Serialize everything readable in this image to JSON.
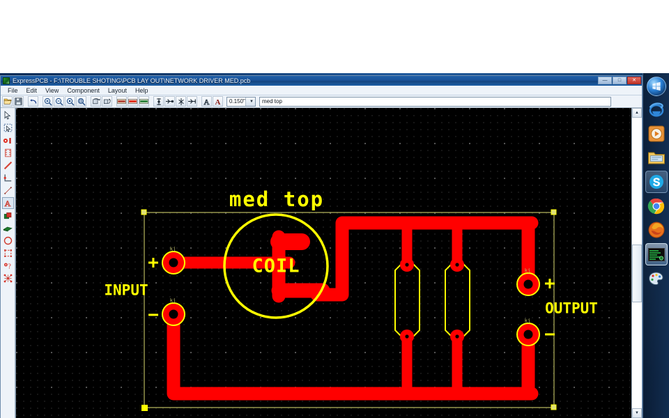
{
  "window": {
    "title": "ExpressPCB - F:\\TROUBLE SHOTING\\PCB LAY OUT\\NETWORK DRIVER MED.pcb",
    "app_icon": "expresspcb-icon",
    "controls": {
      "minimize": "—",
      "maximize": "□",
      "close": "✕"
    }
  },
  "menubar": {
    "items": [
      {
        "label": "File"
      },
      {
        "label": "Edit"
      },
      {
        "label": "View"
      },
      {
        "label": "Component"
      },
      {
        "label": "Layout"
      },
      {
        "label": "Help"
      }
    ]
  },
  "toolbar": {
    "buttons": [
      {
        "name": "open-file-button",
        "icon": "folder-open-icon",
        "tip": "Open"
      },
      {
        "name": "save-file-button",
        "icon": "floppy-disk-icon",
        "tip": "Save"
      },
      {
        "name": "undo-button",
        "icon": "undo-arrow-icon",
        "tip": "Undo"
      },
      {
        "name": "zoom-in-button",
        "icon": "magnifier-plus-icon",
        "tip": "Zoom In"
      },
      {
        "name": "zoom-out-button",
        "icon": "magnifier-minus-icon",
        "tip": "Zoom Out"
      },
      {
        "name": "zoom-fit-button",
        "icon": "magnifier-icon",
        "tip": "Zoom to Fit"
      },
      {
        "name": "zoom-area-button",
        "icon": "magnifier-box-icon",
        "tip": "Zoom Area"
      },
      {
        "name": "rotate-component-button",
        "icon": "rotate-part-icon",
        "tip": "Rotate"
      },
      {
        "name": "flip-component-button",
        "icon": "flip-part-icon",
        "tip": "Flip"
      },
      {
        "name": "top-layer-button",
        "icon": "top-copper-layer-icon",
        "tip": "Top layer"
      },
      {
        "name": "bottom-layer-button",
        "icon": "bottom-copper-layer-icon",
        "tip": "Bottom layer"
      },
      {
        "name": "silkscreen-layer-button",
        "icon": "silkscreen-layer-icon",
        "tip": "Silkscreen layer"
      },
      {
        "name": "insert-via-button",
        "icon": "insert-via-icon",
        "tip": "Insert via"
      },
      {
        "name": "trim-trace-button",
        "icon": "trim-trace-icon",
        "tip": "Trim trace"
      },
      {
        "name": "split-trace-button",
        "icon": "split-trace-icon",
        "tip": "Split trace"
      },
      {
        "name": "extend-trace-button",
        "icon": "extend-trace-icon",
        "tip": "Extend trace"
      },
      {
        "name": "text-small-button",
        "icon": "text-outline-icon",
        "tip": "Text"
      },
      {
        "name": "text-bold-button",
        "icon": "text-bold-icon",
        "tip": "Bold Text"
      }
    ],
    "trace_width": {
      "value": "0.150\"",
      "arrow": "▼"
    },
    "text_field": {
      "value": "med top",
      "placeholder": ""
    }
  },
  "palette": {
    "tools": [
      {
        "name": "select-tool",
        "icon": "arrow-cursor-icon",
        "selected": false
      },
      {
        "name": "select-rectangle-tool",
        "icon": "marquee-select-icon",
        "selected": false
      },
      {
        "name": "place-pad-tool",
        "icon": "pad-icon",
        "selected": false
      },
      {
        "name": "place-component-tool",
        "icon": "component-footprint-icon",
        "selected": false
      },
      {
        "name": "place-trace-tool",
        "icon": "diagonal-trace-icon",
        "selected": false
      },
      {
        "name": "place-trace-corner-tool",
        "icon": "trace-corner-icon",
        "selected": false
      },
      {
        "name": "place-line-tool",
        "icon": "thin-line-icon",
        "selected": false
      },
      {
        "name": "place-text-tool",
        "icon": "letter-a-icon",
        "selected": true
      },
      {
        "name": "place-rect-filled-tool",
        "icon": "filled-rectangle-icon",
        "selected": false
      },
      {
        "name": "place-plane-tool",
        "icon": "copper-plane-icon",
        "selected": false
      },
      {
        "name": "place-circle-tool",
        "icon": "circle-outline-icon",
        "selected": false
      },
      {
        "name": "place-rect-outline-tool",
        "icon": "rect-outline-icon",
        "selected": false
      },
      {
        "name": "insert-via-tool",
        "icon": "via-question-icon",
        "selected": false
      },
      {
        "name": "net-highlight-tool",
        "icon": "net-ratsnest-icon",
        "selected": false
      }
    ]
  },
  "canvas": {
    "board_title": "med top",
    "labels": {
      "coil": "COIL",
      "input": "INPUT",
      "output": "OUTPUT",
      "input_plus": "+",
      "input_minus": "−",
      "output_plus": "+",
      "output_minus": "−",
      "pad_tag": "kj"
    },
    "colors": {
      "background": "#000000",
      "top_copper": "#ff0000",
      "silkscreen": "#ffff00",
      "board_outline": "#cfcf7a",
      "pad_hole": "#000000",
      "selection_handle": "#ffff00"
    },
    "scrollbar": {
      "up_arrow": "▲",
      "down_arrow": "▼"
    }
  },
  "taskbar": {
    "items": [
      {
        "name": "start-orb",
        "icon": "windows-logo-icon",
        "style": "orb"
      },
      {
        "name": "internet-explorer-button",
        "icon": "internet-explorer-icon",
        "style": "plain"
      },
      {
        "name": "windows-media-player-button",
        "icon": "media-player-icon",
        "style": "plain"
      },
      {
        "name": "file-explorer-button",
        "icon": "folder-explorer-icon",
        "style": "plain"
      },
      {
        "name": "skype-button",
        "icon": "skype-icon",
        "style": "box"
      },
      {
        "name": "google-chrome-button",
        "icon": "chrome-icon",
        "style": "plain"
      },
      {
        "name": "firefox-button",
        "icon": "firefox-icon",
        "style": "plain"
      },
      {
        "name": "expresspcb-taskbar-button",
        "icon": "expresspcb-icon",
        "style": "active"
      },
      {
        "name": "paint-button",
        "icon": "paint-palette-icon",
        "style": "plain"
      }
    ]
  }
}
